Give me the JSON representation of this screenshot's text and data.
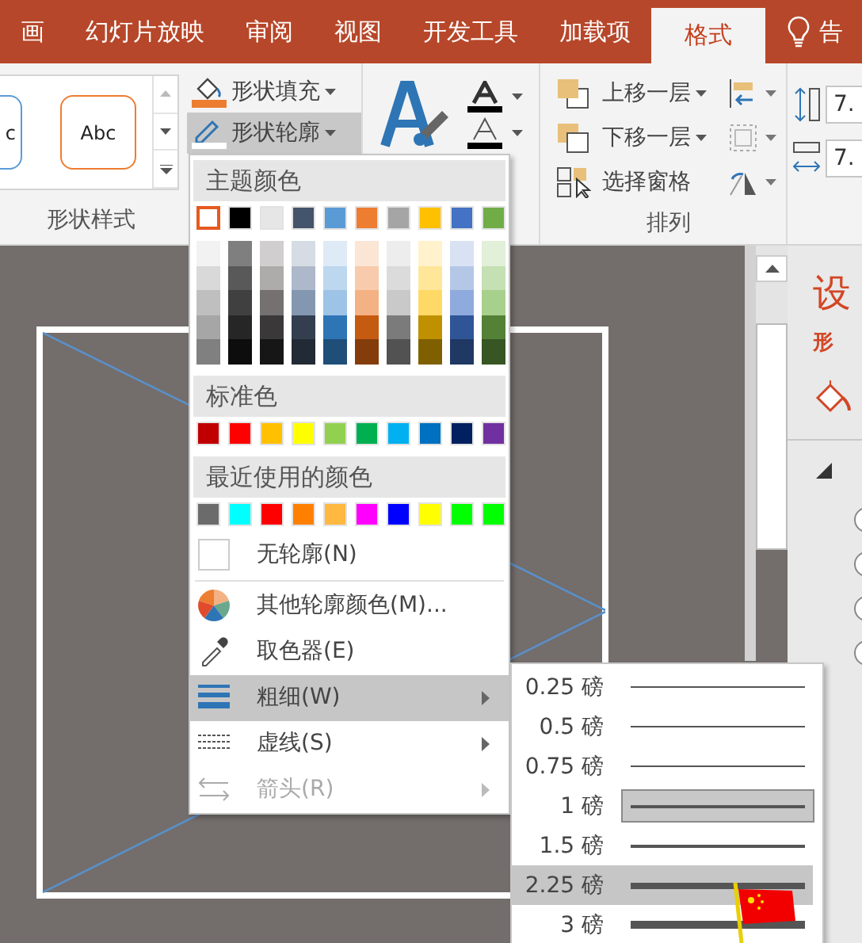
{
  "tabs": [
    {
      "label": "画",
      "selected": false
    },
    {
      "label": "幻灯片放映",
      "selected": false
    },
    {
      "label": "审阅",
      "selected": false
    },
    {
      "label": "视图",
      "selected": false
    },
    {
      "label": "开发工具",
      "selected": false
    },
    {
      "label": "加载项",
      "selected": false
    },
    {
      "label": "格式",
      "selected": true
    }
  ],
  "tell_me": {
    "label": "告"
  },
  "ribbon": {
    "shape_styles": {
      "samples": [
        "c",
        "Abc"
      ],
      "label": "形状样式"
    },
    "fill_button": {
      "label": "形状填充"
    },
    "outline_button": {
      "label": "形状轮廓",
      "pressed": true
    },
    "arrange": {
      "buttons": [
        "上移一层",
        "下移一层",
        "选择窗格"
      ],
      "label": "排列"
    },
    "size": {
      "values": [
        "7.",
        "7."
      ]
    }
  },
  "outline_menu": {
    "theme_header": "主题颜色",
    "theme_colors": [
      {
        "color": "#ffffff",
        "selected": true,
        "shades": [
          {
            "color": "#f2f2f2"
          },
          {
            "color": "#d9d9d9"
          },
          {
            "color": "#bfbfbf"
          },
          {
            "color": "#a6a6a6"
          },
          {
            "color": "#808080"
          }
        ]
      },
      {
        "color": "#000000",
        "selected": false,
        "shades": [
          {
            "color": "#7f7f7f"
          },
          {
            "color": "#595959"
          },
          {
            "color": "#404040"
          },
          {
            "color": "#262626"
          },
          {
            "color": "#0d0d0d"
          }
        ]
      },
      {
        "color": "#e7e6e6",
        "selected": false,
        "shades": [
          {
            "color": "#d0cece"
          },
          {
            "color": "#aeabab"
          },
          {
            "color": "#757171"
          },
          {
            "color": "#3a3838"
          },
          {
            "color": "#171616"
          }
        ]
      },
      {
        "color": "#44546a",
        "selected": false,
        "shades": [
          {
            "color": "#d6dce4"
          },
          {
            "color": "#adb9ca"
          },
          {
            "color": "#8497b0"
          },
          {
            "color": "#333f4f"
          },
          {
            "color": "#222a35"
          }
        ]
      },
      {
        "color": "#5b9bd5",
        "selected": false,
        "shades": [
          {
            "color": "#deebf6"
          },
          {
            "color": "#bdd7ee"
          },
          {
            "color": "#9dc3e6"
          },
          {
            "color": "#2e75b5"
          },
          {
            "color": "#1f4e79"
          }
        ]
      },
      {
        "color": "#ed7d31",
        "selected": false,
        "shades": [
          {
            "color": "#fbe5d5"
          },
          {
            "color": "#f7cbac"
          },
          {
            "color": "#f4b183"
          },
          {
            "color": "#c55a11"
          },
          {
            "color": "#843c0b"
          }
        ]
      },
      {
        "color": "#a5a5a5",
        "selected": false,
        "shades": [
          {
            "color": "#ededed"
          },
          {
            "color": "#dbdbdb"
          },
          {
            "color": "#c9c9c9"
          },
          {
            "color": "#7b7b7b"
          },
          {
            "color": "#525252"
          }
        ]
      },
      {
        "color": "#ffc000",
        "selected": false,
        "shades": [
          {
            "color": "#fff2cc"
          },
          {
            "color": "#ffe699"
          },
          {
            "color": "#ffd966"
          },
          {
            "color": "#bf9000"
          },
          {
            "color": "#7f6000"
          }
        ]
      },
      {
        "color": "#4472c4",
        "selected": false,
        "shades": [
          {
            "color": "#d9e2f3"
          },
          {
            "color": "#b4c7e7"
          },
          {
            "color": "#8faadc"
          },
          {
            "color": "#2f5597"
          },
          {
            "color": "#203864"
          }
        ]
      },
      {
        "color": "#70ad47",
        "selected": false,
        "shades": [
          {
            "color": "#e2efd9"
          },
          {
            "color": "#c5e0b3"
          },
          {
            "color": "#a8d08d"
          },
          {
            "color": "#538135"
          },
          {
            "color": "#375623"
          }
        ]
      }
    ],
    "standard_header": "标准色",
    "standard_colors": [
      {
        "color": "#c00000",
        "selected": false
      },
      {
        "color": "#ff0000",
        "selected": false
      },
      {
        "color": "#ffc000",
        "selected": false
      },
      {
        "color": "#ffff00",
        "selected": false
      },
      {
        "color": "#92d050",
        "selected": false
      },
      {
        "color": "#00b050",
        "selected": false
      },
      {
        "color": "#00b0f0",
        "selected": false
      },
      {
        "color": "#0070c0",
        "selected": false
      },
      {
        "color": "#002060",
        "selected": false
      },
      {
        "color": "#7030a0",
        "selected": false
      }
    ],
    "recent_header": "最近使用的颜色",
    "recent_colors": [
      {
        "color": "#6b6b6b",
        "selected": false
      },
      {
        "color": "#00ffff",
        "selected": false
      },
      {
        "color": "#ff0000",
        "selected": false
      },
      {
        "color": "#ff8000",
        "selected": false
      },
      {
        "color": "#ffb840",
        "selected": false
      },
      {
        "color": "#ff00ff",
        "selected": false
      },
      {
        "color": "#0000ff",
        "selected": false
      },
      {
        "color": "#ffff00",
        "selected": false
      },
      {
        "color": "#00ff00",
        "selected": false
      },
      {
        "color": "#00ff00",
        "selected": false
      }
    ],
    "items": [
      {
        "kind": "no-outline",
        "label": "无轮廓(N)",
        "submenu": false,
        "disabled": false,
        "highlighted": false
      },
      {
        "kind": "more-colors",
        "label": "其他轮廓颜色(M)...",
        "submenu": false,
        "disabled": false,
        "highlighted": false
      },
      {
        "kind": "eyedropper",
        "label": "取色器(E)",
        "submenu": false,
        "disabled": false,
        "highlighted": false
      },
      {
        "kind": "weight",
        "label": "粗细(W)",
        "submenu": true,
        "disabled": false,
        "highlighted": true
      },
      {
        "kind": "dashes",
        "label": "虚线(S)",
        "submenu": true,
        "disabled": false,
        "highlighted": false
      },
      {
        "kind": "arrows",
        "label": "箭头(R)",
        "submenu": true,
        "disabled": true,
        "highlighted": false
      }
    ]
  },
  "weight_menu": {
    "items": [
      {
        "label": "0.25 磅",
        "selected": false,
        "highlighted": false
      },
      {
        "label": "0.5 磅",
        "selected": false,
        "highlighted": false
      },
      {
        "label": "0.75 磅",
        "selected": false,
        "highlighted": false
      },
      {
        "label": "1 磅",
        "selected": true,
        "highlighted": false
      },
      {
        "label": "1.5 磅",
        "selected": false,
        "highlighted": false
      },
      {
        "label": "2.25 磅",
        "selected": false,
        "highlighted": true
      },
      {
        "label": "3 磅",
        "selected": false,
        "highlighted": false
      }
    ]
  },
  "format_pane": {
    "title": "设",
    "subtitle": "形",
    "options": [
      {
        "checked": false
      },
      {
        "checked": false
      },
      {
        "checked": false
      },
      {
        "checked": false
      }
    ]
  }
}
